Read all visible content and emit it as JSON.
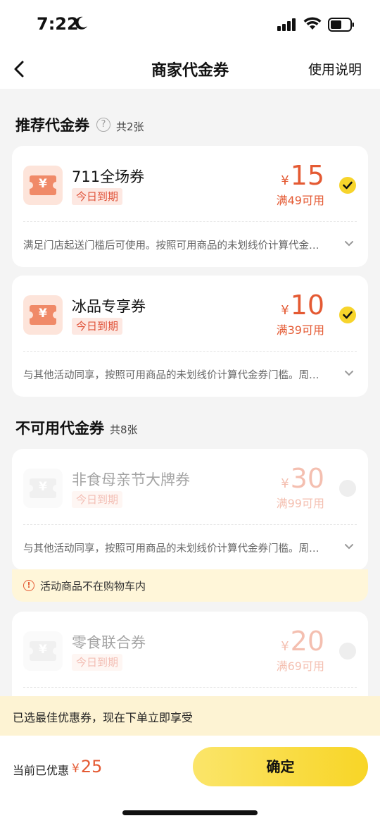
{
  "status_bar": {
    "time": "7:22"
  },
  "nav": {
    "title": "商家代金券",
    "help_label": "使用说明"
  },
  "recommended": {
    "title": "推荐代金券",
    "count": "共2张",
    "coupons": [
      {
        "name": "711全场券",
        "expiry": "今日到期",
        "currency": "¥",
        "amount": "15",
        "condition": "满49可用",
        "description": "满足门店起送门槛后可使用。按照可用商品的未划线价计算代金…",
        "selected": true
      },
      {
        "name": "冰品专享券",
        "expiry": "今日到期",
        "currency": "¥",
        "amount": "10",
        "condition": "满39可用",
        "description": "与其他活动同享，按照可用商品的未划线价计算代金券门槛。周…",
        "selected": true
      }
    ]
  },
  "unavailable": {
    "title": "不可用代金券",
    "count": "共8张",
    "coupons": [
      {
        "name": "非食母亲节大牌券",
        "expiry": "今日到期",
        "currency": "¥",
        "amount": "30",
        "condition": "满99可用",
        "description": "与其他活动同享，按照可用商品的未划线价计算代金券门槛。周…",
        "reason": "活动商品不在购物车内"
      },
      {
        "name": "零食联合券",
        "expiry": "今日到期",
        "currency": "¥",
        "amount": "20",
        "condition": "满69可用"
      }
    ]
  },
  "best_banner": "已选最佳优惠券，现在下单立即享受",
  "footer": {
    "saved_label": "当前已优惠",
    "saved_currency": "¥",
    "saved_amount": "25",
    "confirm_label": "确定"
  },
  "colors": {
    "accent_yellow": "#f8d526",
    "price_red": "#e45a33"
  }
}
